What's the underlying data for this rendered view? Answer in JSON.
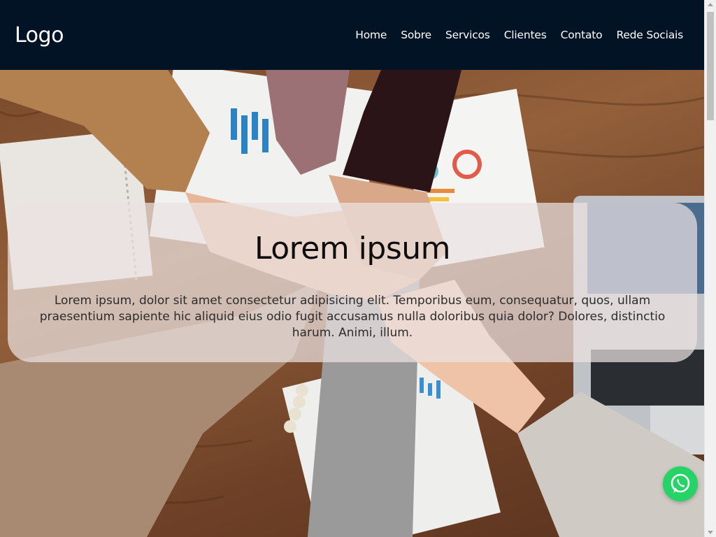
{
  "header": {
    "logo": "Logo",
    "nav": [
      {
        "label": "Home"
      },
      {
        "label": "Sobre"
      },
      {
        "label": "Servicos"
      },
      {
        "label": "Clientes"
      },
      {
        "label": "Contato"
      },
      {
        "label": "Rede Sociais"
      }
    ]
  },
  "hero": {
    "image_subject": "team-hands-stacked-photo",
    "title": "Lorem ipsum",
    "text": "Lorem ipsum, dolor sit amet consectetur adipisicing elit. Temporibus eum, consequatur, quos, ullam praesentium sapiente hic aliquid eius odio fugit accusamus nulla doloribus quia dolor? Dolores, distinctio harum. Animi, illum."
  },
  "whatsapp": {
    "icon": "whatsapp-icon"
  },
  "colors": {
    "navbar_bg": "#021325",
    "nav_text": "#ffffff",
    "whatsapp_green": "#25d366"
  }
}
